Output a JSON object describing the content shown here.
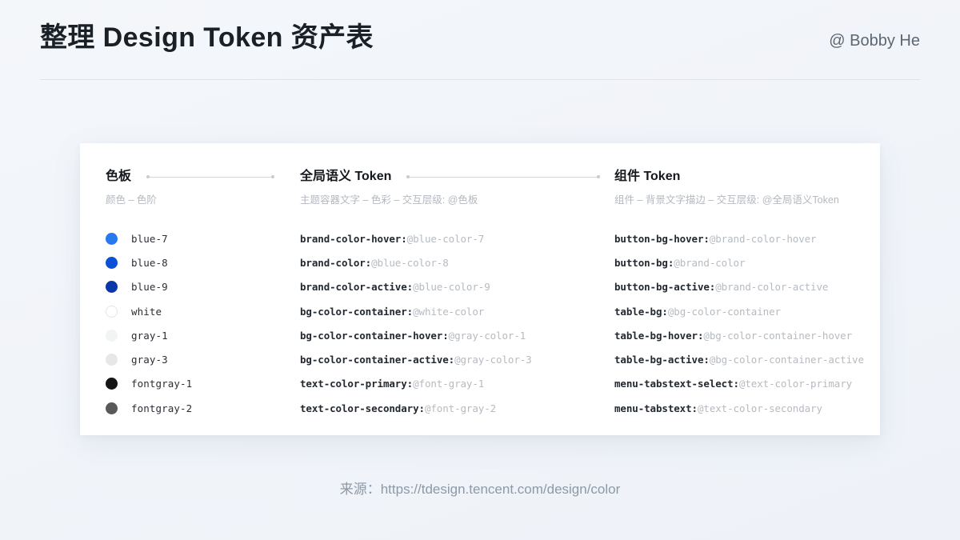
{
  "header": {
    "title": "整理 Design Token 资产表",
    "author": "@ Bobby He"
  },
  "columns": [
    {
      "title": "色板",
      "subtitle": "颜色 – 色阶",
      "swatches": [
        {
          "label": "blue-7",
          "color": "#2878f0",
          "border": false
        },
        {
          "label": "blue-8",
          "color": "#0a51d8",
          "border": false
        },
        {
          "label": "blue-9",
          "color": "#0b38a8",
          "border": false
        },
        {
          "label": "white",
          "color": "#ffffff",
          "border": true
        },
        {
          "label": "gray-1",
          "color": "#f2f3f3",
          "border": false
        },
        {
          "label": "gray-3",
          "color": "#e6e7e8",
          "border": false
        },
        {
          "label": "fontgray-1",
          "color": "#151515",
          "border": false
        },
        {
          "label": "fontgray-2",
          "color": "#595959",
          "border": false
        }
      ]
    },
    {
      "title": "全局语义 Token",
      "subtitle": "主题容器文字 – 色彩 – 交互层级: @色板",
      "tokens": [
        {
          "name": "brand-color-hover:",
          "ref": "@blue-color-7"
        },
        {
          "name": "brand-color:",
          "ref": "@blue-color-8"
        },
        {
          "name": "brand-color-active:",
          "ref": "@blue-color-9"
        },
        {
          "name": "bg-color-container:",
          "ref": "@white-color"
        },
        {
          "name": "bg-color-container-hover:",
          "ref": "@gray-color-1"
        },
        {
          "name": "bg-color-container-active:",
          "ref": "@gray-color-3"
        },
        {
          "name": "text-color-primary:",
          "ref": "@font-gray-1"
        },
        {
          "name": "text-color-secondary:",
          "ref": "@font-gray-2"
        }
      ]
    },
    {
      "title": "组件 Token",
      "subtitle": "组件 – 背景文字描边 – 交互层级: @全局语义Token",
      "tokens": [
        {
          "name": "button-bg-hover:",
          "ref": "@brand-color-hover"
        },
        {
          "name": "button-bg:",
          "ref": "@brand-color"
        },
        {
          "name": "button-bg-active:",
          "ref": "@brand-color-active"
        },
        {
          "name": "table-bg:",
          "ref": "@bg-color-container"
        },
        {
          "name": "table-bg-hover:",
          "ref": "@bg-color-container-hover"
        },
        {
          "name": "table-bg-active:",
          "ref": "@bg-color-container-active"
        },
        {
          "name": "menu-tabstext-select:",
          "ref": "@text-color-primary"
        },
        {
          "name": "menu-tabstext:",
          "ref": "@text-color-secondary"
        }
      ]
    }
  ],
  "footer": {
    "source": "来源：https://tdesign.tencent.com/design/color"
  }
}
